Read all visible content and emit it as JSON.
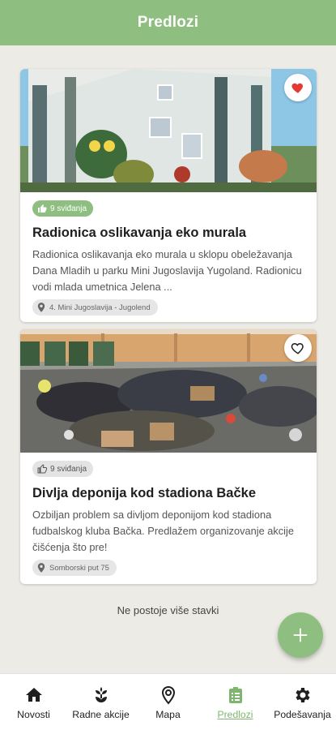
{
  "colors": {
    "primary": "#8fbf80",
    "background": "#ecebe6",
    "heart": "#e53935"
  },
  "appbar": {
    "title": "Predlozi"
  },
  "cards": [
    {
      "likes": "9 sviđanja",
      "liked": true,
      "favorite": true,
      "title": "Radionica oslikavanja eko murala",
      "description": "Radionica oslikavanja eko murala u sklopu obeležavanja Dana Mladih u parku Mini Jugoslavija Yugoland. Radionicu vodi mlada umetnica Jelena ...",
      "location": "4. Mini Jugoslavija - Jugolend",
      "image": "mural-photo"
    },
    {
      "likes": "9 sviđanja",
      "liked": false,
      "favorite": false,
      "title": "Divlja deponija kod stadiona Bačke",
      "description": "Ozbiljan problem sa divljom deponijom kod stadiona fudbalskog kluba Bačka. Predlažem organizovanje akcije čišćenja što pre!",
      "location": "Somborski put 75",
      "image": "landfill-photo"
    }
  ],
  "list_end": "Ne postoje više stavki",
  "fab": {
    "icon": "plus-icon"
  },
  "bottom_nav": [
    {
      "label": "Novosti",
      "icon": "home-icon",
      "active": false
    },
    {
      "label": "Radne akcije",
      "icon": "plant-icon",
      "active": false
    },
    {
      "label": "Mapa",
      "icon": "map-pin-icon",
      "active": false
    },
    {
      "label": "Predlozi",
      "icon": "clipboard-icon",
      "active": true
    },
    {
      "label": "Podešavanja",
      "icon": "gear-icon",
      "active": false
    }
  ]
}
